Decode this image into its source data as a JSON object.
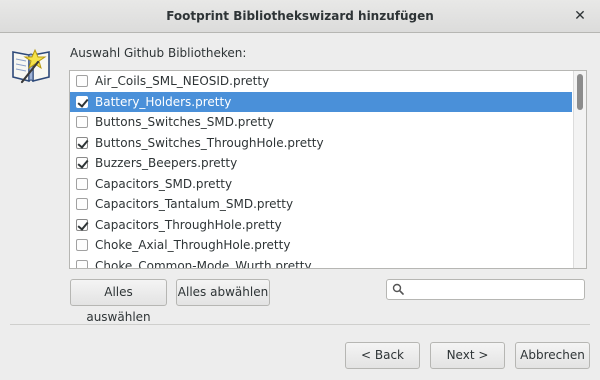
{
  "window": {
    "title": "Footprint Bibliothekswizard hinzufügen",
    "close_glyph": "✕"
  },
  "list": {
    "label": "Auswahl Github Bibliotheken:",
    "items": [
      {
        "label": "Air_Coils_SML_NEOSID.pretty",
        "checked": false,
        "selected": false
      },
      {
        "label": "Battery_Holders.pretty",
        "checked": true,
        "selected": true
      },
      {
        "label": "Buttons_Switches_SMD.pretty",
        "checked": false,
        "selected": false
      },
      {
        "label": "Buttons_Switches_ThroughHole.pretty",
        "checked": true,
        "selected": false
      },
      {
        "label": "Buzzers_Beepers.pretty",
        "checked": true,
        "selected": false
      },
      {
        "label": "Capacitors_SMD.pretty",
        "checked": false,
        "selected": false
      },
      {
        "label": "Capacitors_Tantalum_SMD.pretty",
        "checked": false,
        "selected": false
      },
      {
        "label": "Capacitors_ThroughHole.pretty",
        "checked": true,
        "selected": false
      },
      {
        "label": "Choke_Axial_ThroughHole.pretty",
        "checked": false,
        "selected": false
      },
      {
        "label": "Choke_Common-Mode_Wurth.pretty",
        "checked": false,
        "selected": false
      }
    ]
  },
  "buttons": {
    "select_all": "Alles auswählen",
    "deselect_all": "Alles abwählen",
    "back": "< Back",
    "next": "Next >",
    "cancel": "Abbrechen"
  },
  "search": {
    "value": "",
    "placeholder": ""
  },
  "colors": {
    "selection": "#4a90d9",
    "window_bg": "#ededed"
  },
  "icons": {
    "wizard": "book-wizard-icon",
    "search": "search-icon",
    "close": "close-icon"
  }
}
